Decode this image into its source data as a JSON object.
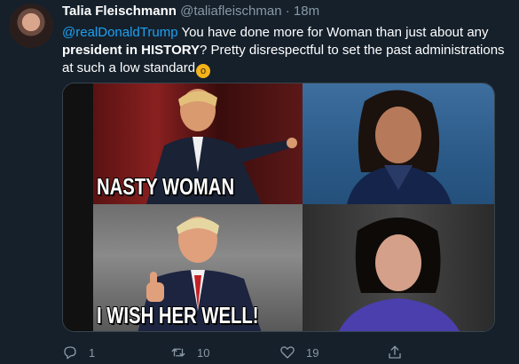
{
  "tweet": {
    "display_name": "Talia Fleischmann",
    "handle": "@taliafleischman",
    "separator": "·",
    "time": "18m",
    "mention": "@realDonaldTrump",
    "text_part1": " You have done more for Woman than just about any ",
    "text_bold": "president in HISTORY",
    "text_part2": "? Pretty disrespectful to set the past administrations at such a low standard",
    "emoji": "😮"
  },
  "media": {
    "caption_top": "NASTY WOMAN",
    "caption_bottom": "I WISH HER WELL!"
  },
  "actions": {
    "reply_count": "1",
    "retweet_count": "10",
    "like_count": "19",
    "share_count": ""
  },
  "colors": {
    "background": "#15202b",
    "accent": "#1da1f2",
    "muted": "#8899a6"
  }
}
